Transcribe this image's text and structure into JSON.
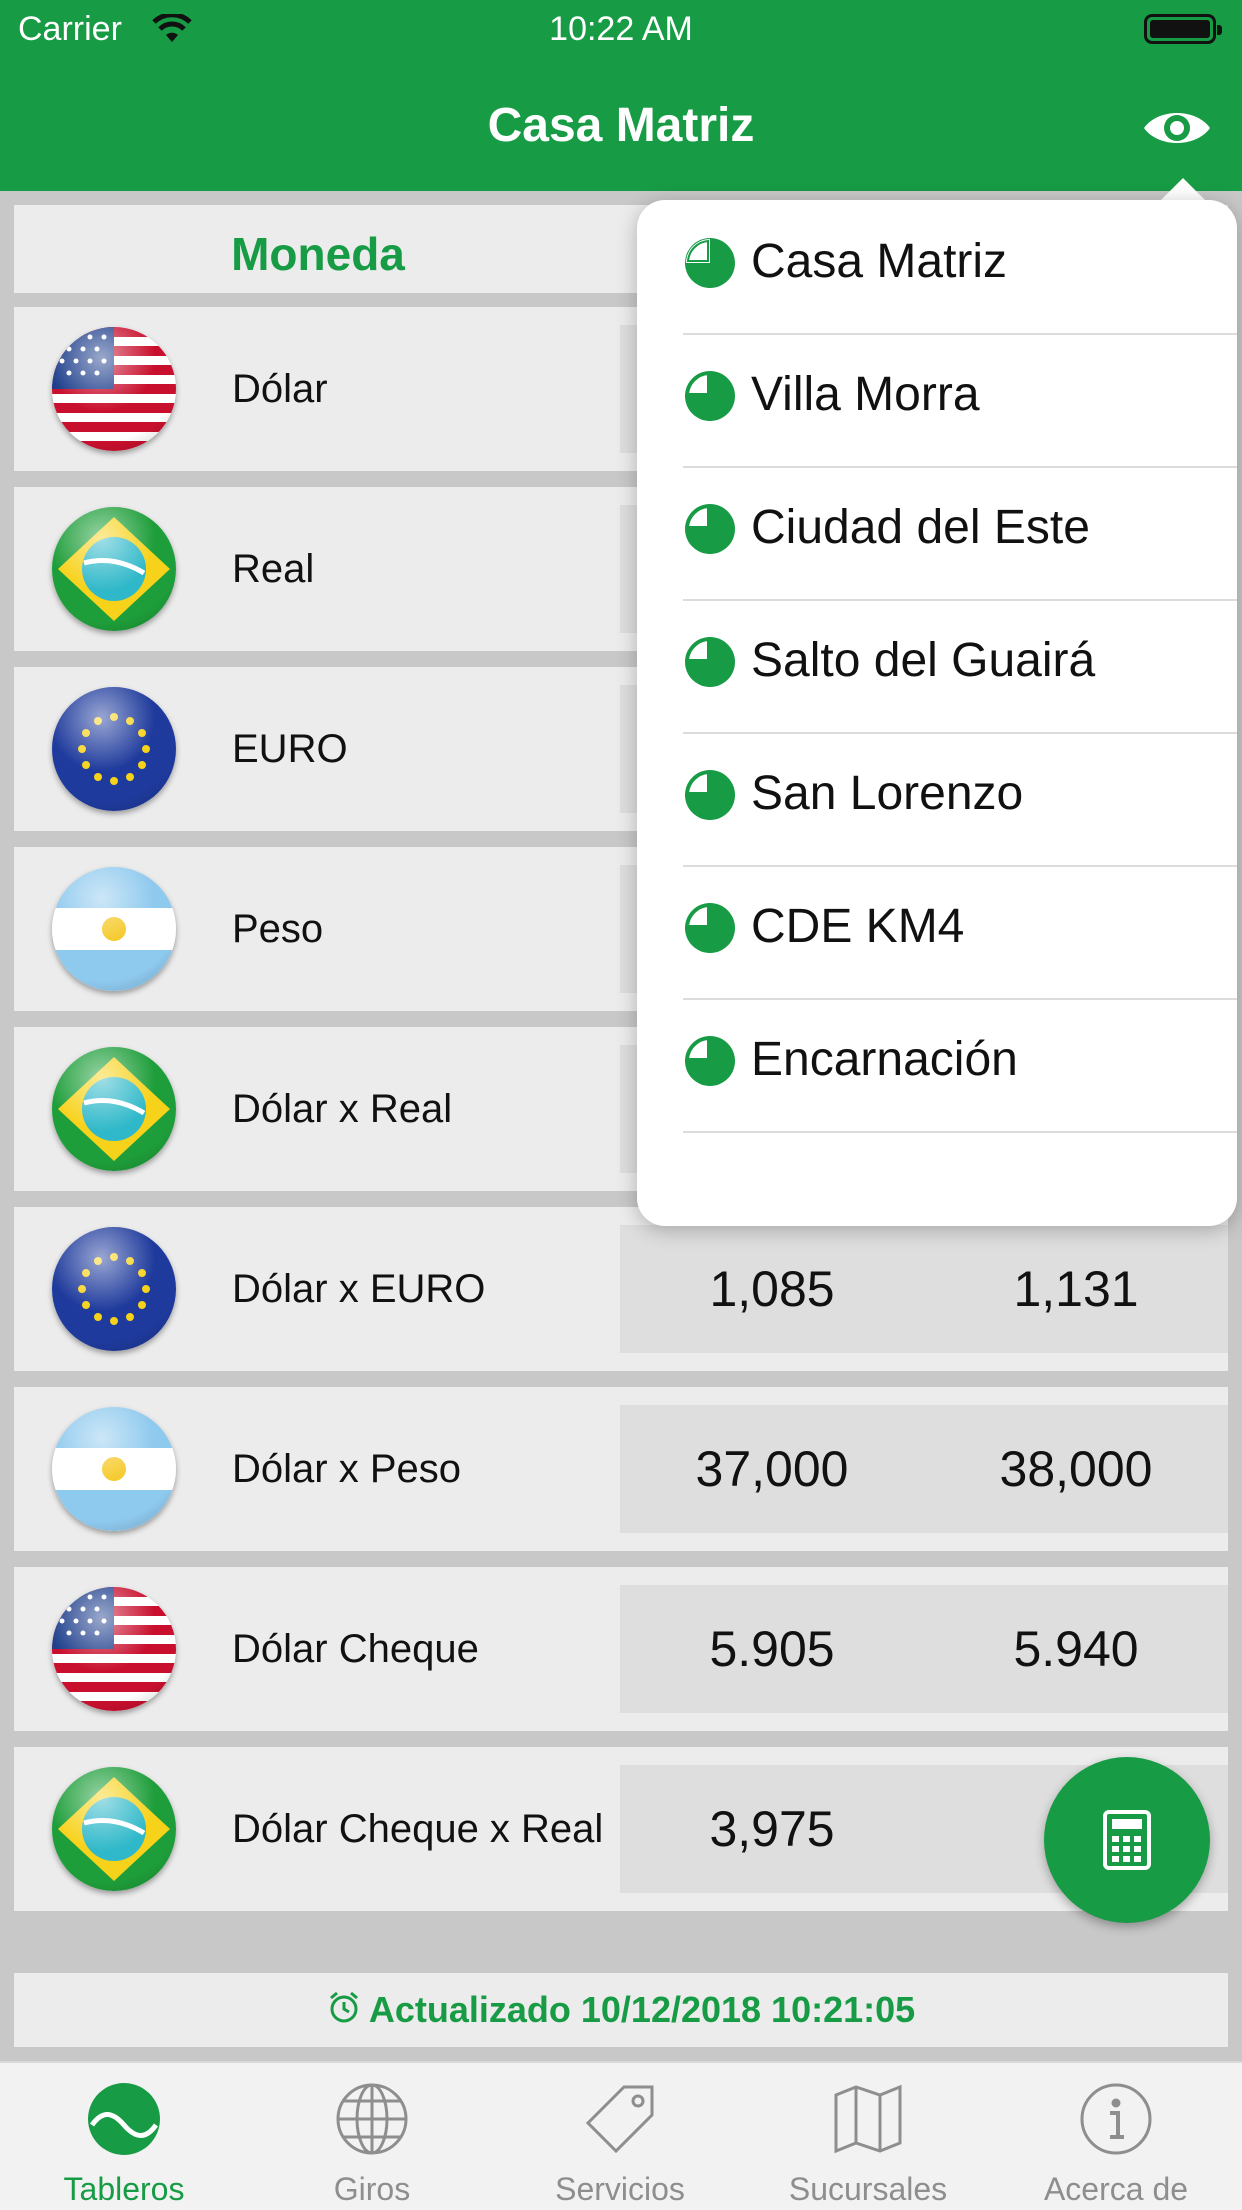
{
  "status_bar": {
    "carrier": "Carrier",
    "time": "10:22 AM"
  },
  "nav": {
    "title": "Casa Matriz",
    "icon": "eye-icon"
  },
  "table": {
    "column_header": "Moneda",
    "rows": [
      {
        "name": "Dólar",
        "flag": "usa-flag-icon",
        "buy": "",
        "sell": ""
      },
      {
        "name": "Real",
        "flag": "brazil-flag-icon",
        "buy": "",
        "sell": ""
      },
      {
        "name": "EURO",
        "flag": "eu-flag-icon",
        "buy": "",
        "sell": ""
      },
      {
        "name": "Peso",
        "flag": "argentina-flag-icon",
        "buy": "",
        "sell": ""
      },
      {
        "name": "Dólar x Real",
        "flag": "brazil-flag-icon",
        "buy": "",
        "sell": ""
      },
      {
        "name": "Dólar x EURO",
        "flag": "eu-flag-icon",
        "buy": "1,085",
        "sell": "1,131"
      },
      {
        "name": "Dólar x Peso",
        "flag": "argentina-flag-icon",
        "buy": "37,000",
        "sell": "38,000"
      },
      {
        "name": "Dólar Cheque",
        "flag": "usa-flag-icon",
        "buy": "5.905",
        "sell": "5.940"
      },
      {
        "name": "Dólar Cheque x Real",
        "flag": "brazil-flag-icon",
        "buy": "3,975",
        "sell": "4,"
      }
    ]
  },
  "updated": {
    "text": "Actualizado 10/12/2018 10:21:05"
  },
  "dropdown": {
    "items": [
      {
        "label": "Casa Matriz"
      },
      {
        "label": "Villa Morra"
      },
      {
        "label": "Ciudad del Este"
      },
      {
        "label": "Salto del Guairá"
      },
      {
        "label": "San Lorenzo"
      },
      {
        "label": "CDE KM4"
      },
      {
        "label": "Encarnación"
      }
    ]
  },
  "fab": {
    "icon": "calculator-icon"
  },
  "tabbar": {
    "tabs": [
      {
        "label": "Tableros",
        "icon": "dashboard-icon",
        "active": true
      },
      {
        "label": "Giros",
        "icon": "globe-icon",
        "active": false
      },
      {
        "label": "Servicios",
        "icon": "tag-icon",
        "active": false
      },
      {
        "label": "Sucursales",
        "icon": "map-icon",
        "active": false
      },
      {
        "label": "Acerca de",
        "icon": "info-icon",
        "active": false
      }
    ]
  },
  "colors": {
    "brand_green": "#179b45",
    "row_bg": "#ececec",
    "value_bg": "#dedede"
  }
}
